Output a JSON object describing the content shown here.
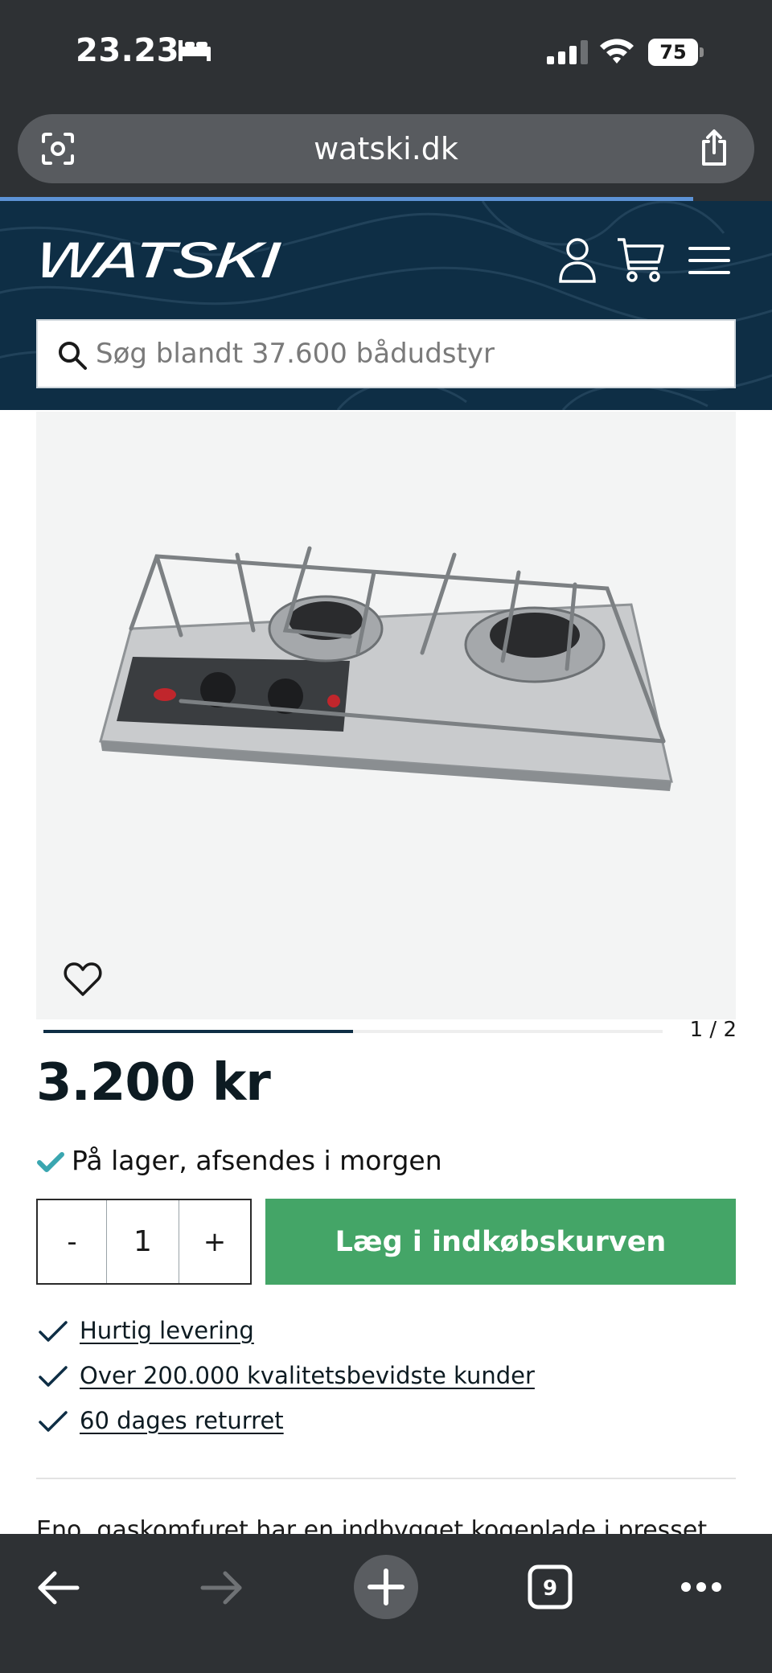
{
  "status_bar": {
    "time": "23.23",
    "battery": "75"
  },
  "browser": {
    "url": "watski.dk",
    "tab_count": "9"
  },
  "site": {
    "logo_text": "WATSKI",
    "search_placeholder": "Søg blandt 37.600 bådudstyr"
  },
  "product": {
    "image_counter": "1 / 2",
    "carousel_progress": 0.5,
    "price": "3.200 kr",
    "stock_text": "På lager, afsendes i morgen",
    "quantity": "1",
    "minus_label": "-",
    "plus_label": "+",
    "add_to_cart_label": "Læg i indkøbskurven",
    "usps": [
      "Hurtig levering",
      "Over 200.000 kvalitetsbevidste kunder",
      "60 dages returret"
    ],
    "description_partial": "Eno, gaskomfuret har en indbygget kogeplade i presset"
  },
  "icons": {
    "status": [
      "bed-icon",
      "signal-icon",
      "wifi-icon",
      "battery-icon"
    ],
    "url_bar": [
      "page-scan-icon",
      "share-icon"
    ],
    "header": [
      "account-icon",
      "cart-icon",
      "menu-icon"
    ],
    "search": "search-icon",
    "product": [
      "favorite-heart-icon",
      "check-icon"
    ],
    "bottom_bar": [
      "back-arrow-icon",
      "forward-arrow-icon",
      "new-tab-plus-icon",
      "tabs-icon",
      "more-icon"
    ]
  },
  "colors": {
    "browser_chrome": "#2e3134",
    "header_bg": "#0e2e45",
    "add_to_cart": "#44a567",
    "check": "#3aa6b0",
    "load_progress": "#5d93d6"
  }
}
